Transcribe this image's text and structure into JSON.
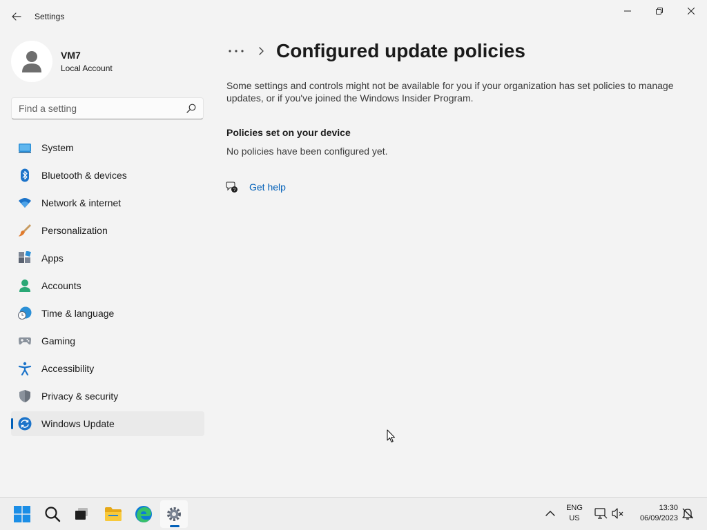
{
  "window": {
    "title": "Settings"
  },
  "profile": {
    "name": "VM7",
    "account_type": "Local Account"
  },
  "search": {
    "placeholder": "Find a setting"
  },
  "sidebar": {
    "items": [
      {
        "label": "System",
        "icon": "system-icon"
      },
      {
        "label": "Bluetooth & devices",
        "icon": "bluetooth-icon"
      },
      {
        "label": "Network & internet",
        "icon": "wifi-icon"
      },
      {
        "label": "Personalization",
        "icon": "brush-icon"
      },
      {
        "label": "Apps",
        "icon": "apps-icon"
      },
      {
        "label": "Accounts",
        "icon": "accounts-icon"
      },
      {
        "label": "Time & language",
        "icon": "clock-globe-icon"
      },
      {
        "label": "Gaming",
        "icon": "gamepad-icon"
      },
      {
        "label": "Accessibility",
        "icon": "accessibility-icon"
      },
      {
        "label": "Privacy & security",
        "icon": "shield-icon"
      },
      {
        "label": "Windows Update",
        "icon": "update-icon",
        "selected": true
      }
    ]
  },
  "main": {
    "breadcrumb_more": "•••",
    "title": "Configured update policies",
    "notice": "Some settings and controls might not be available for you if your organization has set policies to manage updates, or if you've joined the Windows Insider Program.",
    "section_heading": "Policies set on your device",
    "section_body": "No policies have been configured yet.",
    "help_link": "Get help"
  },
  "taskbar": {
    "language_line1": "ENG",
    "language_line2": "US",
    "time": "13:30",
    "date": "06/09/2023"
  },
  "colors": {
    "accent": "#005fb8",
    "background": "#f3f3f3",
    "taskbar": "#eeeeee"
  }
}
